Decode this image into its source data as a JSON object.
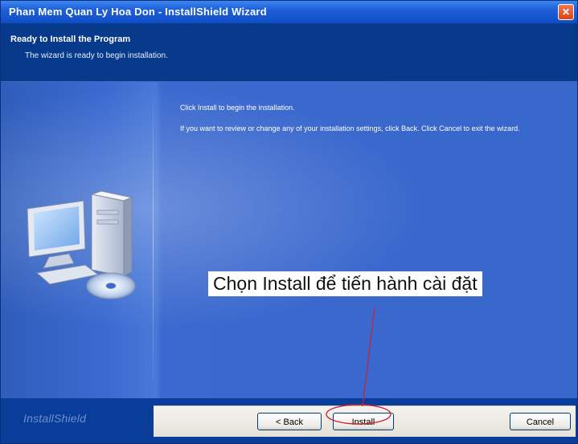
{
  "window": {
    "title": "Phan Mem Quan Ly Hoa Don - InstallShield Wizard",
    "close_glyph": "✕"
  },
  "header": {
    "title": "Ready to Install the Program",
    "subtitle": "The wizard is ready to begin installation."
  },
  "content": {
    "line1": "Click Install to begin the installation.",
    "line2": "If you want to review or change any of your installation settings, click Back. Click Cancel to exit the wizard.",
    "illustration_icon": "computer-install-icon"
  },
  "annotation": {
    "text": "Chọn Install để tiến hành cài đặt",
    "callout_color": "#cc2233"
  },
  "footer": {
    "brand": "InstallShield",
    "back_label": "< Back",
    "install_label": "Install",
    "cancel_label": "Cancel"
  },
  "colors": {
    "title_bar": "#1e5fd9",
    "header_bg": "#073a8a",
    "content_bg": "#3867cb",
    "button_border": "#003c74"
  }
}
